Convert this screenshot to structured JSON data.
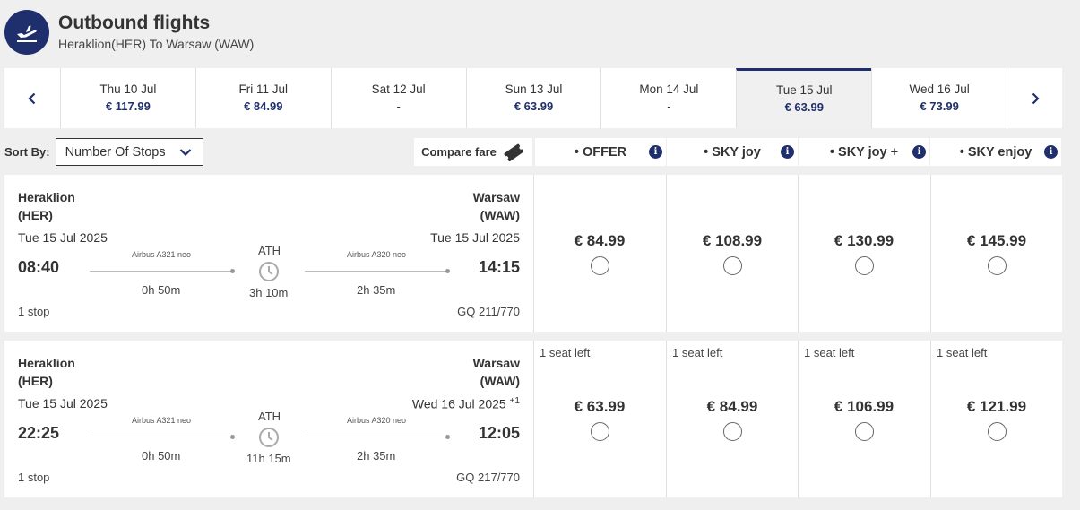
{
  "header": {
    "title": "Outbound flights",
    "subtitle": "Heraklion(HER) To Warsaw (WAW)",
    "icon": "plane-departure-icon"
  },
  "dates": [
    {
      "label": "Thu 10 Jul",
      "price": "€ 117.99"
    },
    {
      "label": "Fri 11 Jul",
      "price": "€ 84.99"
    },
    {
      "label": "Sat 12 Jul",
      "price": "-"
    },
    {
      "label": "Sun 13 Jul",
      "price": "€ 63.99"
    },
    {
      "label": "Mon 14 Jul",
      "price": "-"
    },
    {
      "label": "Tue 15 Jul",
      "price": "€ 63.99",
      "selected": true
    },
    {
      "label": "Wed 16 Jul",
      "price": "€ 73.99"
    }
  ],
  "sort": {
    "label": "Sort By:",
    "value": "Number Of Stops"
  },
  "fare_header": {
    "compare": "Compare fare",
    "fares": [
      "• OFFER",
      "• SKY joy",
      "• SKY joy +",
      "• SKY enjoy"
    ],
    "info": "i"
  },
  "flights": [
    {
      "origin_city": "Heraklion",
      "origin_code": "(HER)",
      "dest_city": "Warsaw",
      "dest_code": "(WAW)",
      "dep_date": "Tue 15 Jul 2025",
      "arr_date": "Tue 15 Jul 2025",
      "arr_plus": "",
      "dep_time": "08:40",
      "arr_time": "14:15",
      "aircraft1": "Airbus A321 neo",
      "aircraft2": "Airbus A320 neo",
      "leg1": "0h 50m",
      "leg2": "2h 35m",
      "stop_code": "ATH",
      "layover": "3h 10m",
      "stops": "1 stop",
      "flight_no": "GQ 211/770",
      "fares": [
        {
          "price": "€ 84.99",
          "seats": ""
        },
        {
          "price": "€ 108.99",
          "seats": ""
        },
        {
          "price": "€ 130.99",
          "seats": ""
        },
        {
          "price": "€ 145.99",
          "seats": ""
        }
      ]
    },
    {
      "origin_city": "Heraklion",
      "origin_code": "(HER)",
      "dest_city": "Warsaw",
      "dest_code": "(WAW)",
      "dep_date": "Tue 15 Jul 2025",
      "arr_date": "Wed 16 Jul 2025",
      "arr_plus": "+1",
      "dep_time": "22:25",
      "arr_time": "12:05",
      "aircraft1": "Airbus A321 neo",
      "aircraft2": "Airbus A320 neo",
      "leg1": "0h 50m",
      "leg2": "2h 35m",
      "stop_code": "ATH",
      "layover": "11h 15m",
      "stops": "1 stop",
      "flight_no": "GQ 217/770",
      "fares": [
        {
          "price": "€ 63.99",
          "seats": "1 seat left"
        },
        {
          "price": "€ 84.99",
          "seats": "1 seat left"
        },
        {
          "price": "€ 106.99",
          "seats": "1 seat left"
        },
        {
          "price": "€ 121.99",
          "seats": "1 seat left"
        }
      ]
    }
  ],
  "colors": {
    "brand": "#1f2f6e",
    "background": "#efefef"
  }
}
